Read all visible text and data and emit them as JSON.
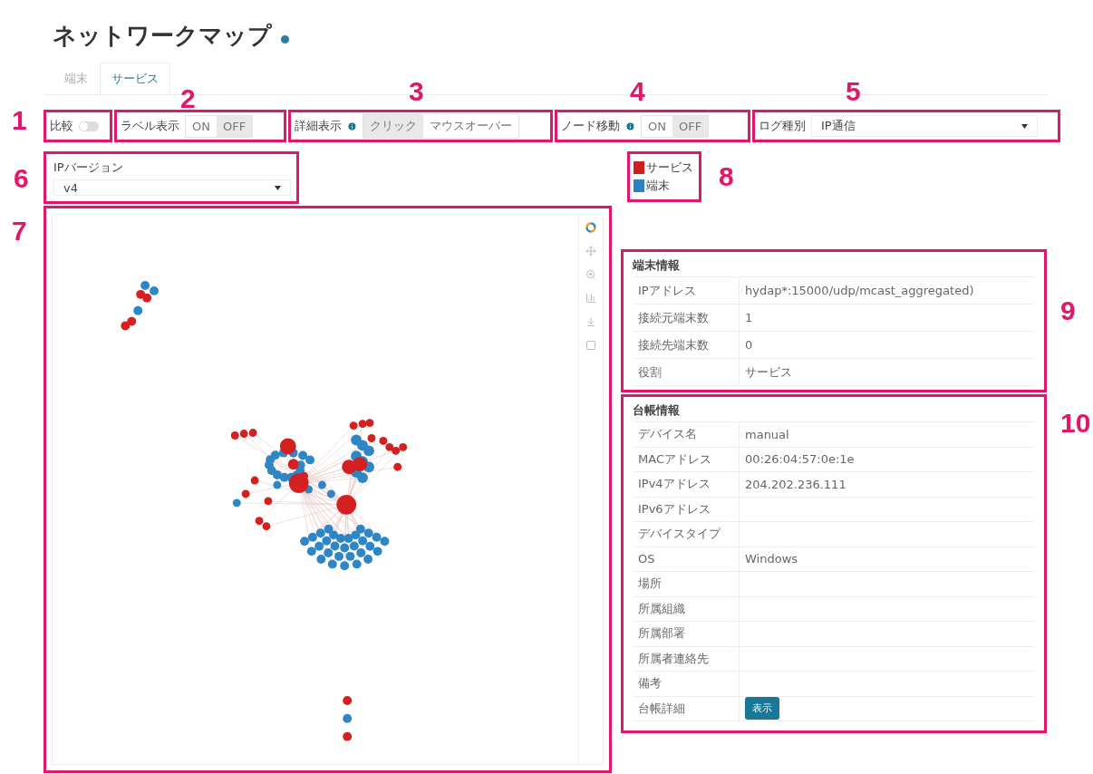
{
  "title": "ネットワークマップ",
  "tabs": [
    {
      "label": "端末",
      "selected": false
    },
    {
      "label": "サービス",
      "selected": true
    }
  ],
  "controls": [
    {
      "kind": "switch",
      "callout": "1",
      "label": "比較",
      "on": false
    },
    {
      "kind": "toggle",
      "callout": "2",
      "label": "ラベル表示",
      "info": false,
      "options": [
        {
          "label": "ON",
          "selected": false
        },
        {
          "label": "OFF",
          "selected": true
        }
      ]
    },
    {
      "kind": "toggle",
      "callout": "3",
      "label": "詳細表示",
      "info": true,
      "options": [
        {
          "label": "クリック",
          "selected": true
        },
        {
          "label": "マウスオーバー",
          "selected": false
        }
      ]
    },
    {
      "kind": "toggle",
      "callout": "4",
      "label": "ノード移動",
      "info": true,
      "options": [
        {
          "label": "ON",
          "selected": false
        },
        {
          "label": "OFF",
          "selected": true
        }
      ]
    },
    {
      "kind": "select",
      "callout": "5",
      "label": "ログ種別",
      "value": "IP通信"
    }
  ],
  "ip_version": {
    "callout": "6",
    "label": "IPバージョン",
    "value": "v4"
  },
  "graph": {
    "callout": "7"
  },
  "legend": {
    "callout": "8",
    "items": [
      {
        "label": "サービス",
        "color": "#cc2020"
      },
      {
        "label": "端末",
        "color": "#2f80c0"
      }
    ]
  },
  "terminal_info": {
    "callout": "9",
    "title": "端末情報",
    "rows": [
      {
        "label": "IPアドレス",
        "value": "hydap*:15000/udp/mcast_aggregated)"
      },
      {
        "label": "接続元端末数",
        "value": "1"
      },
      {
        "label": "接続先端末数",
        "value": "0"
      },
      {
        "label": "役割",
        "value": "サービス"
      }
    ]
  },
  "ledger_info": {
    "callout": "10",
    "title": "台帳情報",
    "rows": [
      {
        "label": "デバイス名",
        "value": "manual"
      },
      {
        "label": "MACアドレス",
        "value": "00:26:04:57:0e:1e"
      },
      {
        "label": "IPv4アドレス",
        "value": "204.202.236.111"
      },
      {
        "label": "IPv6アドレス"
      },
      {
        "label": "デバイスタイプ"
      },
      {
        "label": "OS",
        "value": "Windows"
      },
      {
        "label": "場所"
      },
      {
        "label": "所属組織"
      },
      {
        "label": "所属部署"
      },
      {
        "label": "所属者連絡先"
      },
      {
        "label": "備考"
      },
      {
        "label": "台帳詳細",
        "button": "表示"
      }
    ]
  }
}
